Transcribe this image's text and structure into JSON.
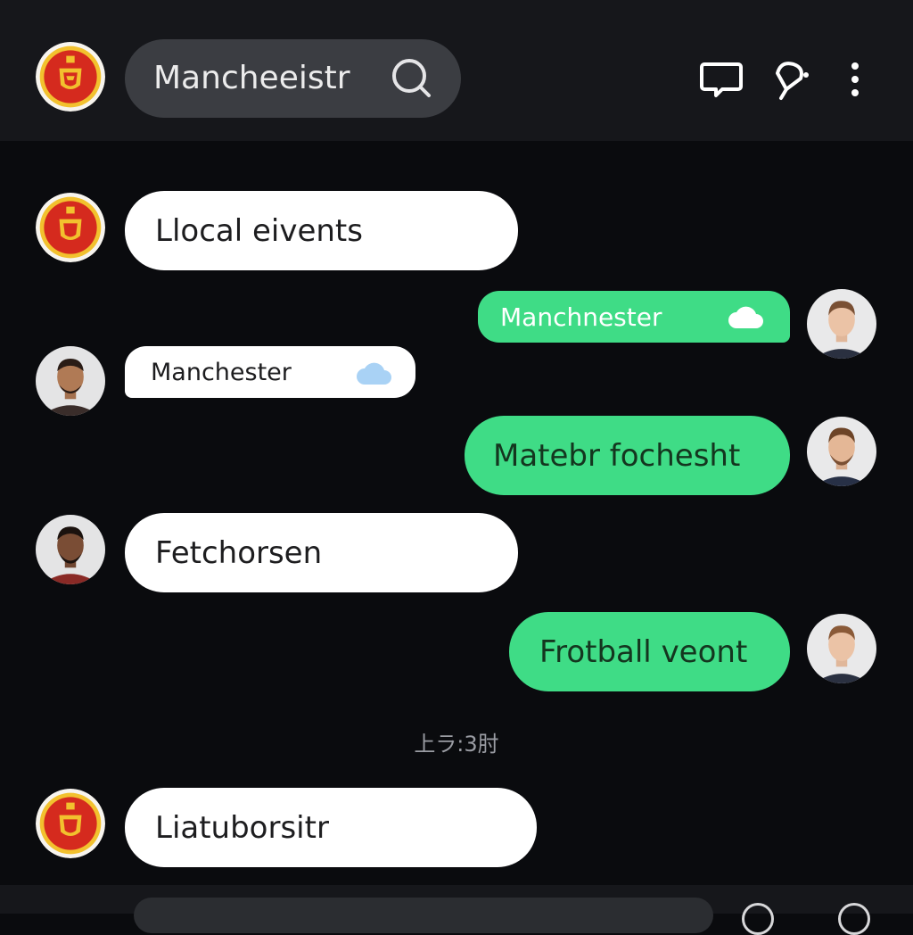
{
  "header": {
    "search_text": "Mancheeistr",
    "icons": [
      "manchester-united-crest",
      "search-icon",
      "chat-bubble-icon",
      "pin-icon",
      "more-vertical-icon"
    ]
  },
  "messages": [
    {
      "direction": "incoming",
      "sender_avatar": "club-crest",
      "text": "Llocal eivents"
    },
    {
      "direction": "outgoing",
      "sender_avatar": "user-photo",
      "text": "Manchnester",
      "icon": "cloud-icon"
    },
    {
      "direction": "incoming",
      "sender_avatar": "user-photo",
      "text": "Manchester",
      "icon": "cloud-icon"
    },
    {
      "direction": "outgoing",
      "sender_avatar": "user-photo",
      "text": "Matebr fochesht"
    },
    {
      "direction": "incoming",
      "sender_avatar": "user-photo",
      "text": "Fetchorsen"
    },
    {
      "direction": "outgoing",
      "sender_avatar": "user-photo",
      "text": "Frotball veont"
    },
    {
      "direction": "incoming",
      "sender_avatar": "club-crest",
      "text": "Liatuborsitr"
    }
  ],
  "timestamp": "上ラ:3肘",
  "colors": {
    "background": "#0a0b0e",
    "header": "#16171b",
    "incoming_bubble": "#ffffff",
    "outgoing_bubble": "#3fdc86",
    "crest_red": "#d52a1e",
    "crest_gold": "#f2c12e"
  }
}
